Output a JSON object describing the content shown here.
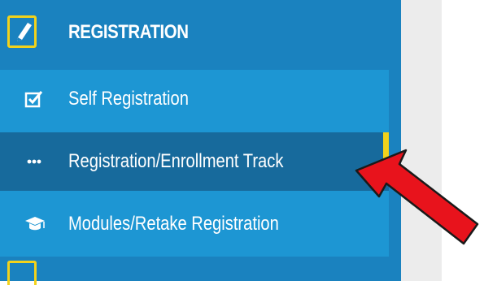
{
  "section": {
    "title": "REGISTRATION",
    "icon": "edit-icon"
  },
  "menu": {
    "items": [
      {
        "label": "Self Registration",
        "icon": "checkbox-icon",
        "active": false
      },
      {
        "label": "Registration/Enrollment Track",
        "icon": "dots-icon",
        "active": true
      },
      {
        "label": "Modules/Retake Registration",
        "icon": "graduation-cap-icon",
        "active": false
      }
    ]
  },
  "colors": {
    "sidebar_bg": "#1a82bf",
    "submenu_bg": "#1d96d3",
    "active_bg": "#176a9c",
    "accent_yellow": "#f2d21b",
    "arrow_red": "#e8131c"
  },
  "annotation": {
    "type": "red-arrow",
    "points_to": "Registration/Enrollment Track"
  }
}
